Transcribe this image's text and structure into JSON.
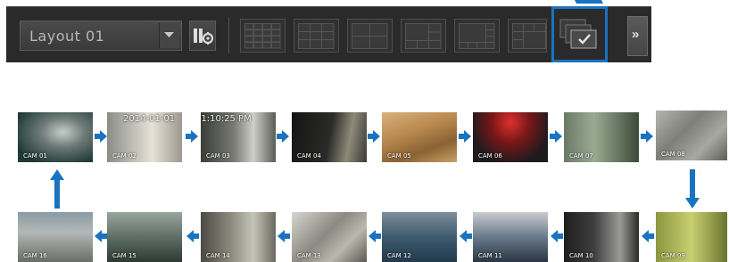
{
  "toolbar": {
    "layout_value": "Layout 01",
    "more_label": "»",
    "grid_buttons": [
      "grid-4x4",
      "grid-3x3",
      "grid-2x2",
      "grid-1+5",
      "grid-1+7",
      "grid-custom"
    ],
    "accent_color": "#1a73c0"
  },
  "sequence": {
    "overlay": {
      "date": "2014-01-01",
      "time": "01:10:25 PM"
    },
    "cameras": [
      {
        "label": "CAM 01"
      },
      {
        "label": "CAM 02"
      },
      {
        "label": "CAM 03"
      },
      {
        "label": "CAM 04"
      },
      {
        "label": "CAM 05"
      },
      {
        "label": "CAM 06"
      },
      {
        "label": "CAM 07"
      },
      {
        "label": "CAM 08"
      },
      {
        "label": "CAM 09"
      },
      {
        "label": "CAM 10"
      },
      {
        "label": "CAM 11"
      },
      {
        "label": "CAM 12"
      },
      {
        "label": "CAM 13"
      },
      {
        "label": "CAM 14"
      },
      {
        "label": "CAM 15"
      },
      {
        "label": "CAM 16"
      }
    ],
    "arrow_color": "#1a73c0"
  }
}
